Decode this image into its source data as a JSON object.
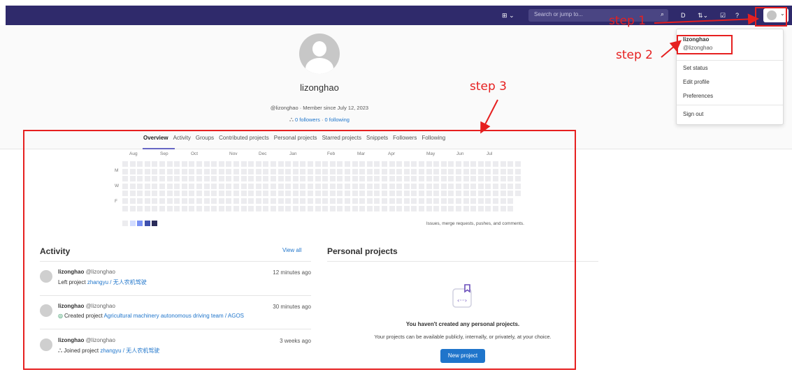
{
  "topbar": {
    "new_icon": "plus-square-icon",
    "search_placeholder": "Search or jump to...",
    "search_icon": "search-icon",
    "icons": [
      "issues-icon",
      "merge-request-icon",
      "todo-icon",
      "help-icon"
    ],
    "chevron": "⌄"
  },
  "profile": {
    "username": "lizonghao",
    "meta": "@lizonghao  ·  Member since July 12, 2023",
    "followers": "0 followers",
    "following": "0 following",
    "dot": "·"
  },
  "tabs": [
    "Overview",
    "Activity",
    "Groups",
    "Contributed projects",
    "Personal projects",
    "Starred projects",
    "Snippets",
    "Followers",
    "Following"
  ],
  "heatmap": {
    "months": [
      "Aug",
      "Sep",
      "Oct",
      "Nov",
      "Dec",
      "Jan",
      "Feb",
      "Mar",
      "Apr",
      "May",
      "Jun",
      "Jul"
    ],
    "day_labels": [
      "M",
      "W",
      "F"
    ],
    "note": "Issues, merge requests, pushes, and comments.",
    "legend_colors": [
      "#ececef",
      "#d2dcff",
      "#7992f5",
      "#3f51ae",
      "#2a2b59"
    ]
  },
  "activity": {
    "title": "Activity",
    "view_all": "View all",
    "items": [
      {
        "name": "lizonghao",
        "handle": "@lizonghao",
        "time": "12 minutes ago",
        "action": "Left project",
        "project": "zhangyu / 无人农机驾驶",
        "icon": ""
      },
      {
        "name": "lizonghao",
        "handle": "@lizonghao",
        "time": "30 minutes ago",
        "action": "Created project",
        "project": "Agricultural machinery autonomous driving team / AGOS",
        "icon": "◎"
      },
      {
        "name": "lizonghao",
        "handle": "@lizonghao",
        "time": "3 weeks ago",
        "action": "Joined project",
        "project": "zhangyu / 无人农机驾驶",
        "icon": "ஃ"
      }
    ]
  },
  "personal_projects": {
    "title": "Personal projects",
    "empty_title": "You haven't created any personal projects.",
    "empty_sub": "Your projects can be available publicly, internally, or privately, at your choice.",
    "button": "New project"
  },
  "dropdown": {
    "name": "lizonghao",
    "handle": "@lizonghao",
    "items": [
      "Set status",
      "Edit profile",
      "Preferences",
      "Sign out"
    ]
  },
  "annotations": {
    "step1": "step 1",
    "step2": "step 2",
    "step3": "step 3",
    "color": "#e62020"
  }
}
